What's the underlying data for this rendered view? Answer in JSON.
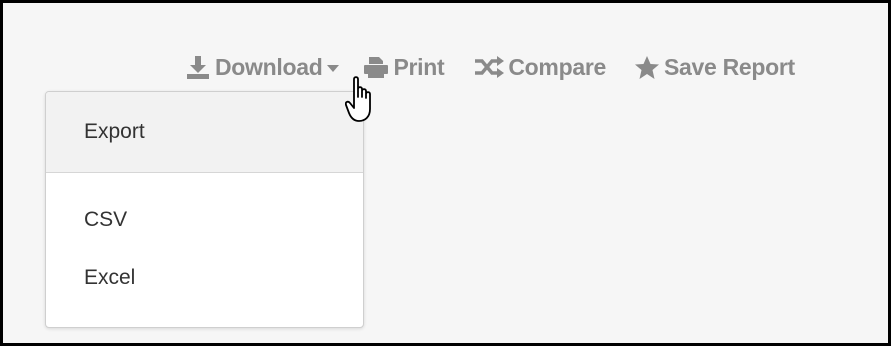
{
  "toolbar": {
    "download_label": "Download",
    "print_label": "Print",
    "compare_label": "Compare",
    "save_report_label": "Save Report"
  },
  "dropdown": {
    "header": "Export",
    "items": [
      {
        "label": "CSV"
      },
      {
        "label": "Excel"
      }
    ]
  },
  "icons": {
    "download": "download-icon",
    "print": "printer-icon",
    "compare": "shuffle-icon",
    "save_report": "star-icon",
    "caret": "caret-down-icon",
    "cursor": "hand-pointer-cursor"
  },
  "colors": {
    "toolbar_text": "#8a8a8a",
    "background": "#f6f6f6",
    "dropdown_header_bg": "#f2f2f2",
    "text": "#333333"
  }
}
